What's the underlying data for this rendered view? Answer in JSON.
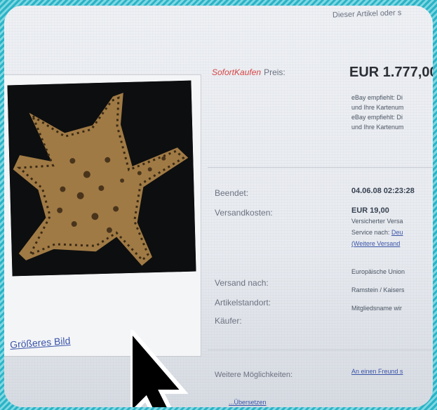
{
  "header": {
    "note": "Dieser Artikel oder s"
  },
  "price": {
    "logo": "SofortKaufen",
    "label": "Preis:",
    "amount": "EUR 1.777,00",
    "notes": [
      "eBay empfiehlt: Di",
      "und Ihre Kartenum",
      "eBay empfiehlt: Di",
      "und Ihre Kartenum"
    ]
  },
  "details": {
    "ended_label": "Beendet:",
    "ended_value": "04.06.08 02:23:28",
    "shipping_label": "Versandkosten:",
    "shipping_value": "EUR 19,00",
    "shipping_line1": "Versicherter Versa",
    "shipping_service_prefix": "Service nach:",
    "shipping_service_link": "Deu",
    "shipping_more_link": "(Weitere Versand",
    "ship_to_label": "Versand nach:",
    "ship_to_value": "Europäische Union",
    "location_label": "Artikelstandort:",
    "location_value": "Ramstein / Kaisers",
    "buyer_label": "Käufer:",
    "buyer_value": "Mitgliedsname wir"
  },
  "image_panel": {
    "bigger_link": "Größeres Bild"
  },
  "more": {
    "label": "Weitere Möglichkeiten:",
    "link": "An einen Freund s",
    "bottom_link": "...Übersetzen"
  },
  "colors": {
    "accent_red": "#d64545",
    "link_blue": "#3b55a8",
    "frame": "#2bb3c6"
  },
  "icons": {
    "cursor": "mouse-pointer-icon"
  }
}
